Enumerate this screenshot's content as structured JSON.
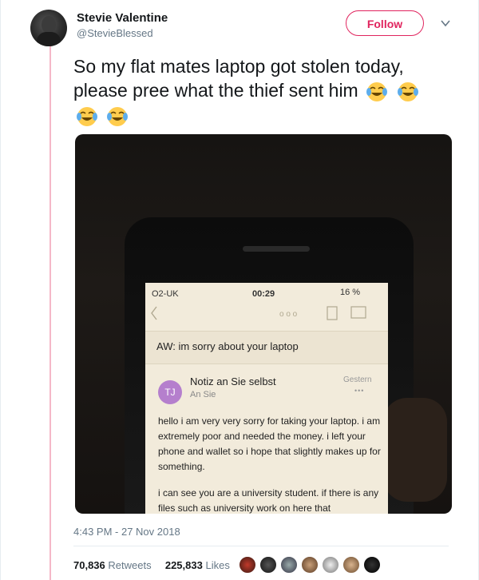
{
  "author": {
    "name": "Stevie Valentine",
    "handle": "@StevieBlessed"
  },
  "follow_label": "Follow",
  "tweet_text": "So my flat mates laptop got stolen today, please pree what the thief sent him",
  "emoji_icon": "face-with-tears-of-joy-icon",
  "emoji_count": 4,
  "photo": {
    "status": {
      "carrier": "O2-UK",
      "time": "00:29",
      "battery": "16 %"
    },
    "subject": "AW: im sorry about your laptop",
    "avatar_initials": "TJ",
    "sender": "Notiz an Sie selbst",
    "recipient": "An Sie",
    "date": "Gestern",
    "body": [
      "hello i am very very sorry for taking your laptop. i am extremely poor and needed the money. i left your phone and wallet so i hope that slightly makes up for something.",
      "i can see you are a university student. if there is any files such as university work on here that"
    ]
  },
  "timestamp": "4:43 PM - 27 Nov 2018",
  "stats": {
    "retweets_count": "70,836",
    "retweets_label": "Retweets",
    "likes_count": "225,833",
    "likes_label": "Likes"
  },
  "colors": {
    "accent": "#e0245e",
    "thread_line": "#f5b8c8",
    "muted": "#657786"
  }
}
